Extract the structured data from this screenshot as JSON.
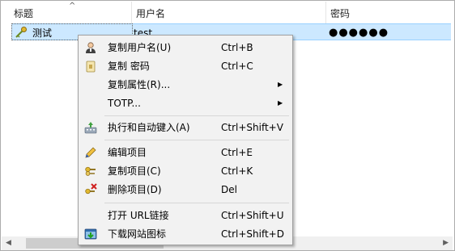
{
  "columns": {
    "title": "标题",
    "username": "用户名",
    "password": "密码"
  },
  "row": {
    "title": "测试",
    "username": "test",
    "password": "●●●●●●"
  },
  "menu": {
    "copy_username": {
      "label": "复制用户名(U)",
      "shortcut": "Ctrl+B"
    },
    "copy_password": {
      "label": "复制 密码",
      "shortcut": "Ctrl+C"
    },
    "copy_attribute": {
      "label": "复制属性(R)..."
    },
    "totp": {
      "label": "TOTP..."
    },
    "auto_type": {
      "label": "执行和自动键入(A)",
      "shortcut": "Ctrl+Shift+V"
    },
    "edit_entry": {
      "label": "编辑项目",
      "shortcut": "Ctrl+E"
    },
    "duplicate_entry": {
      "label": "复制项目(C)",
      "shortcut": "Ctrl+K"
    },
    "delete_entry": {
      "label": "删除项目(D)",
      "shortcut": "Del"
    },
    "open_url": {
      "label": "打开 URL链接",
      "shortcut": "Ctrl+Shift+U"
    },
    "download_favicon": {
      "label": "下载网站图标",
      "shortcut": "Ctrl+Shift+D"
    }
  },
  "icons": {
    "entry": "key-icon",
    "user": "user-icon",
    "password": "lock-icon",
    "auto_type": "keyboard-icon",
    "edit": "pencil-icon",
    "duplicate": "copy-key-icon",
    "delete": "delete-key-icon",
    "download": "download-icon"
  },
  "colors": {
    "selection": "#cce8ff",
    "menu_bg": "#f2f2f2"
  }
}
